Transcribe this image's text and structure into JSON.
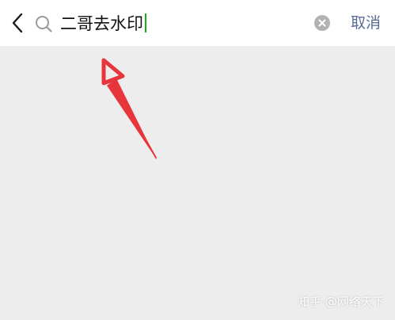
{
  "search": {
    "query": "二哥去水印",
    "cancel_label": "取消"
  },
  "icons": {
    "back": "chevron-left-icon",
    "search": "search-icon",
    "clear": "close-circle-icon"
  },
  "watermark": {
    "text": "知乎 @网络天下"
  },
  "colors": {
    "header_bg": "#ffffff",
    "page_bg": "#ededed",
    "cancel_text": "#576b95",
    "caret": "#1aad19",
    "annotation_arrow": "#e8353b"
  }
}
